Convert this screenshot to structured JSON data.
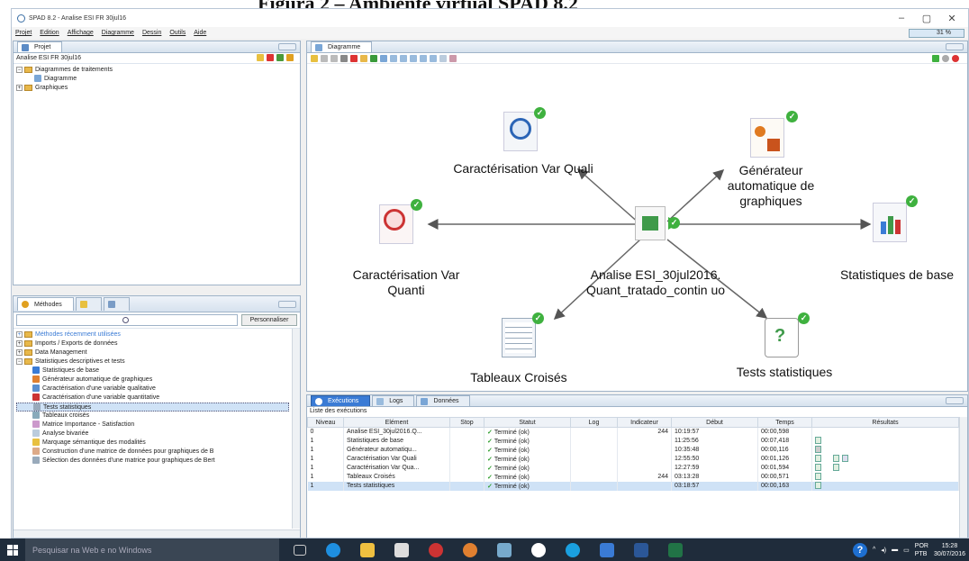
{
  "doc_title": "Figura 2 – Ambiente virtual SPAD 8.2",
  "window": {
    "title": "SPAD 8.2 - Analise ESI FR 30jul16",
    "minimize": "–",
    "maximize": "▢",
    "close": "✕"
  },
  "menu": [
    "Projet",
    "Edition",
    "Affichage",
    "Diagramme",
    "Dessin",
    "Outils",
    "Aide"
  ],
  "zoom": "31 %",
  "projet_panel": {
    "tab": "Projet",
    "subtitle": "Analise ESI FR 30jul16",
    "tree": [
      {
        "label": "Diagrammes de traitements",
        "level": 0,
        "expanded": true
      },
      {
        "label": "Diagramme",
        "level": 1
      },
      {
        "label": "Graphiques",
        "level": 0,
        "expanded": false
      }
    ]
  },
  "methodes_panel": {
    "tab": "Méthodes",
    "button": "Personnaliser",
    "items": [
      {
        "label": "Méthodes récemment utilisées",
        "level": 0,
        "faded": true
      },
      {
        "label": "Imports / Exports de données",
        "level": 0
      },
      {
        "label": "Data Management",
        "level": 0
      },
      {
        "label": "Statistiques descriptives et tests",
        "level": 0
      },
      {
        "label": "Statistiques de base",
        "level": 1
      },
      {
        "label": "Générateur automatique de graphiques",
        "level": 1
      },
      {
        "label": "Caractérisation d'une variable qualitative",
        "level": 1
      },
      {
        "label": "Caractérisation d'une variable quantitative",
        "level": 1
      },
      {
        "label": "Tests statistiques",
        "level": 1,
        "selected": true
      },
      {
        "label": "Tableaux croisés",
        "level": 1
      },
      {
        "label": "Matrice Importance - Satisfaction",
        "level": 1
      },
      {
        "label": "Analyse bivariée",
        "level": 1
      },
      {
        "label": "Marquage sémantique des modalités",
        "level": 1
      },
      {
        "label": "Construction d'une matrice de données pour graphiques de B",
        "level": 1
      },
      {
        "label": "Sélection des données d'une matrice pour graphiques de Bert",
        "level": 1
      }
    ]
  },
  "diagram_panel": {
    "tab": "Diagramme",
    "nodes": {
      "center": "Analise ESI_30jul2016. Quant_tratado_contin uo",
      "car_quali": "Caractérisation Var Quali",
      "generateur": "Générateur automatique de graphiques",
      "car_quanti": "Caractérisation Var Quanti",
      "stats": "Statistiques de base",
      "tableaux": "Tableaux Croisés",
      "tests": "Tests statistiques"
    }
  },
  "exec_panel": {
    "tabs": [
      "Exécutions",
      "Logs",
      "Données"
    ],
    "list_title": "Liste des exécutions",
    "columns": [
      "Niveau",
      "Elément",
      "Stop",
      "Statut",
      "Log",
      "Indicateur",
      "Début",
      "Temps",
      "Résultats"
    ],
    "rows": [
      {
        "niveau": "0",
        "element": "Analise ESI_30jul2016.Q...",
        "statut": "Terminé (ok)",
        "indicateur": "244",
        "debut": "10:19:57",
        "temps": "00:00,598"
      },
      {
        "niveau": "1",
        "element": "Statistiques de base",
        "statut": "Terminé (ok)",
        "indicateur": "",
        "debut": "11:25:56",
        "temps": "00:07,418"
      },
      {
        "niveau": "1",
        "element": "Générateur automatiqu...",
        "statut": "Terminé (ok)",
        "indicateur": "",
        "debut": "10:35:48",
        "temps": "00:00,116"
      },
      {
        "niveau": "1",
        "element": "Caractérisation Var Quali",
        "statut": "Terminé (ok)",
        "indicateur": "",
        "debut": "12:55:50",
        "temps": "00:01,126"
      },
      {
        "niveau": "1",
        "element": "Caractérisation Var Qua...",
        "statut": "Terminé (ok)",
        "indicateur": "",
        "debut": "12:27:59",
        "temps": "00:01,594"
      },
      {
        "niveau": "1",
        "element": "Tableaux Croisés",
        "statut": "Terminé (ok)",
        "indicateur": "244",
        "debut": "03:13:28",
        "temps": "00:00,571"
      },
      {
        "niveau": "1",
        "element": "Tests statistiques",
        "statut": "Terminé (ok)",
        "indicateur": "",
        "debut": "03:18:57",
        "temps": "00:00,163",
        "selected": true
      }
    ]
  },
  "taskbar": {
    "search": "Pesquisar na Web e no Windows",
    "lang": "POR",
    "layout": "PTB",
    "time": "15:28",
    "date": "30/07/2016"
  }
}
